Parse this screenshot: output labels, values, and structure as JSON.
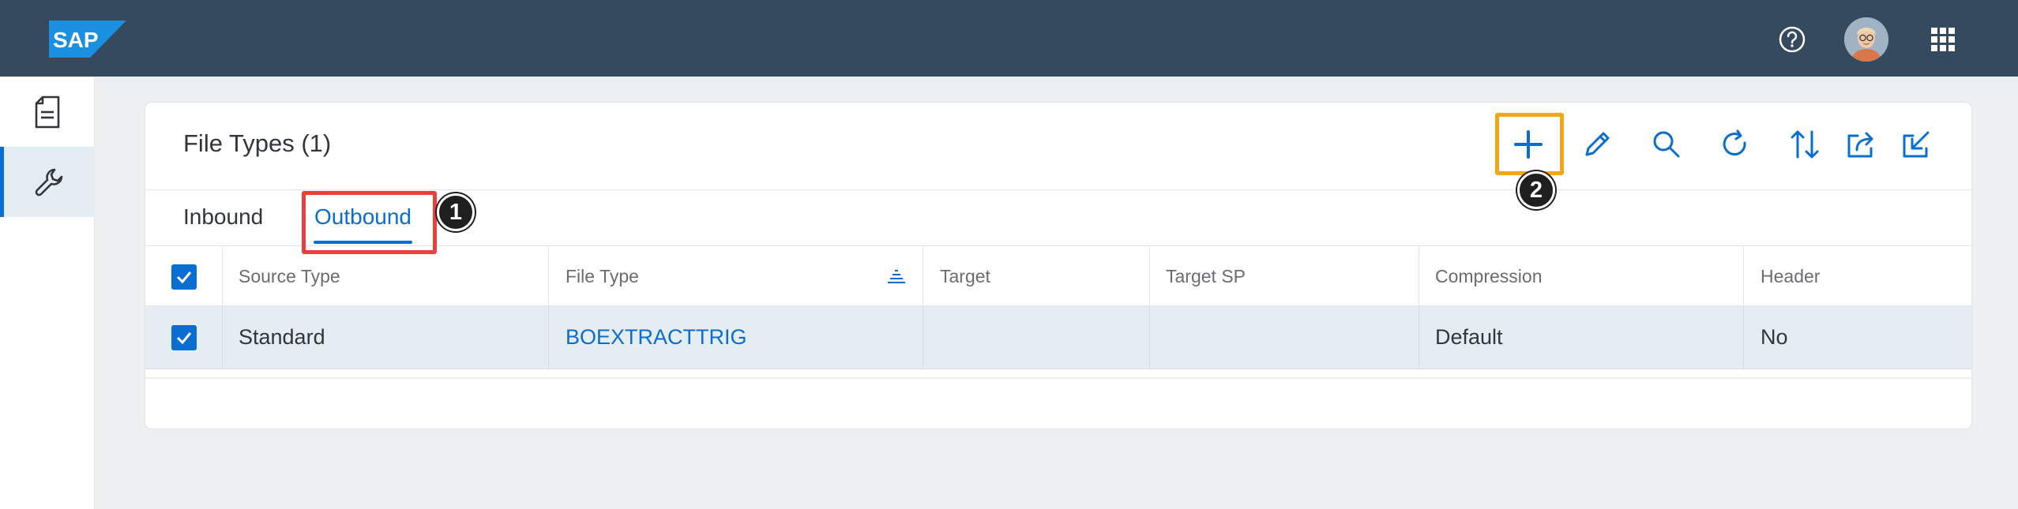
{
  "shell": {
    "logo_text": "SAP",
    "help_icon": "help-circle-icon",
    "user_avatar": "user-avatar",
    "apps_icon": "grid-icon",
    "colors": {
      "header_bg": "#354a5f",
      "accent": "#0a6ed1"
    }
  },
  "sidenav": {
    "items": [
      {
        "icon": "document-icon",
        "selected": false
      },
      {
        "icon": "wrench-icon",
        "selected": true
      }
    ]
  },
  "card": {
    "title": "File Types (1)",
    "toolbar": [
      {
        "name": "add",
        "icon": "plus-icon"
      },
      {
        "name": "edit",
        "icon": "pencil-icon"
      },
      {
        "name": "search",
        "icon": "search-icon"
      },
      {
        "name": "refresh",
        "icon": "refresh-icon"
      },
      {
        "name": "sort",
        "icon": "sort-icon"
      },
      {
        "name": "export",
        "icon": "export-icon"
      },
      {
        "name": "import",
        "icon": "import-icon"
      }
    ],
    "tabs": [
      {
        "label": "Inbound",
        "selected": false
      },
      {
        "label": "Outbound",
        "selected": true
      }
    ]
  },
  "table": {
    "columns": [
      "Source Type",
      "File Type",
      "Target",
      "Target SP",
      "Compression",
      "Header"
    ],
    "rows": [
      {
        "source_type": "Standard",
        "file_type": "BOEXTRACTTRIG",
        "target": "",
        "target_sp": "",
        "compression": "Default",
        "header": "No",
        "selected": true
      }
    ]
  },
  "annotations": {
    "step1": "1",
    "step2": "2"
  }
}
